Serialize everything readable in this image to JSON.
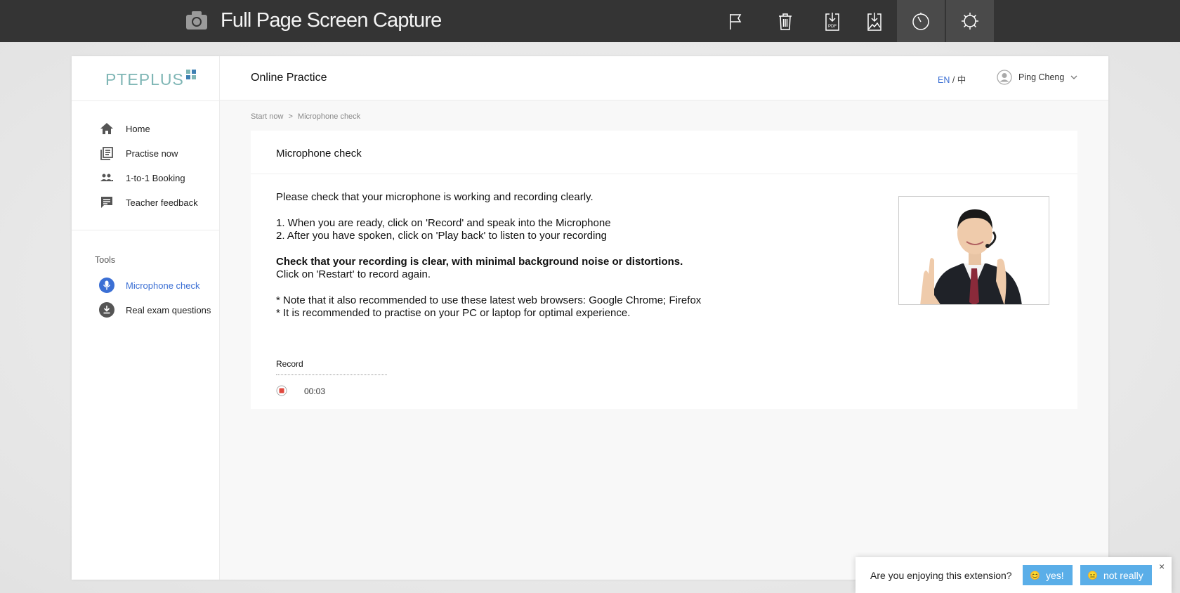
{
  "extension": {
    "title": "Full Page Screen Capture",
    "buttons": [
      {
        "name": "flag-icon"
      },
      {
        "name": "trash-icon"
      },
      {
        "name": "download-pdf-icon",
        "text": "PDF"
      },
      {
        "name": "download-image-icon"
      },
      {
        "name": "timer-icon",
        "active": true
      },
      {
        "name": "gear-icon",
        "active": true
      }
    ]
  },
  "logo": {
    "text": "PTEPLUS"
  },
  "sidebar": {
    "items": [
      {
        "label": "Home",
        "icon": "home-icon"
      },
      {
        "label": "Practise now",
        "icon": "list-icon"
      },
      {
        "label": "1-to-1 Booking",
        "icon": "people-icon"
      },
      {
        "label": "Teacher feedback",
        "icon": "feedback-icon"
      }
    ],
    "tools_label": "Tools",
    "tools": [
      {
        "label": "Microphone check",
        "icon": "microphone-icon",
        "active": true
      },
      {
        "label": "Real exam questions",
        "icon": "download-circle-icon"
      }
    ]
  },
  "header": {
    "title": "Online Practice",
    "lang_en": "EN",
    "lang_sep": " / ",
    "lang_zh": "中",
    "user_name": "Ping Cheng"
  },
  "breadcrumb": {
    "root": "Start now",
    "sep": ">",
    "current": "Microphone check"
  },
  "panel": {
    "title": "Microphone check",
    "intro": "Please check that your microphone is working and recording clearly.",
    "step1": "1. When you are ready, click on 'Record' and speak into the Microphone",
    "step2": "2. After you have spoken, click on 'Play back' to listen to your recording",
    "bold_note": "Check that your recording is clear, with minimal background noise or distortions.",
    "restart_note": "Click on 'Restart' to record again.",
    "browser_note": "* Note that it also recommended to use these latest web browsers: Google Chrome; Firefox",
    "device_note": "* It is recommended to practise on your PC or laptop for optimal experience.",
    "record_label": "Record",
    "record_time": "00:03"
  },
  "feedback": {
    "question": "Are you enjoying this extension?",
    "yes": "yes!",
    "no": "not really",
    "close": "×"
  },
  "colors": {
    "accent": "#3b6fd4",
    "logo": "#7fb6b5",
    "toolbar": "#343434",
    "feedback_button": "#5aaee8",
    "record": "#e04a3f"
  }
}
